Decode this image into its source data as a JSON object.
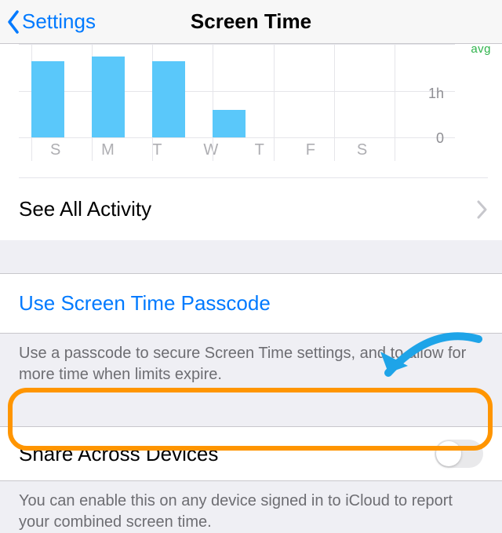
{
  "nav": {
    "back_label": "Settings",
    "title": "Screen Time"
  },
  "chart_data": {
    "type": "bar",
    "categories": [
      "S",
      "M",
      "T",
      "W",
      "T",
      "F",
      "S"
    ],
    "values": [
      1.65,
      1.75,
      1.65,
      0.6,
      0,
      0,
      0
    ],
    "title": "",
    "xlabel": "",
    "ylabel": "",
    "ylim": [
      0,
      2
    ],
    "ytick_labels": [
      "0",
      "1h"
    ],
    "avg_label": "avg"
  },
  "see_all": {
    "label": "See All Activity"
  },
  "passcode": {
    "label": "Use Screen Time Passcode",
    "footer": "Use a passcode to secure Screen Time settings, and to allow for more time when limits expire."
  },
  "share": {
    "label": "Share Across Devices",
    "on": false,
    "footer": "You can enable this on any device signed in to iCloud to report your combined screen time."
  }
}
